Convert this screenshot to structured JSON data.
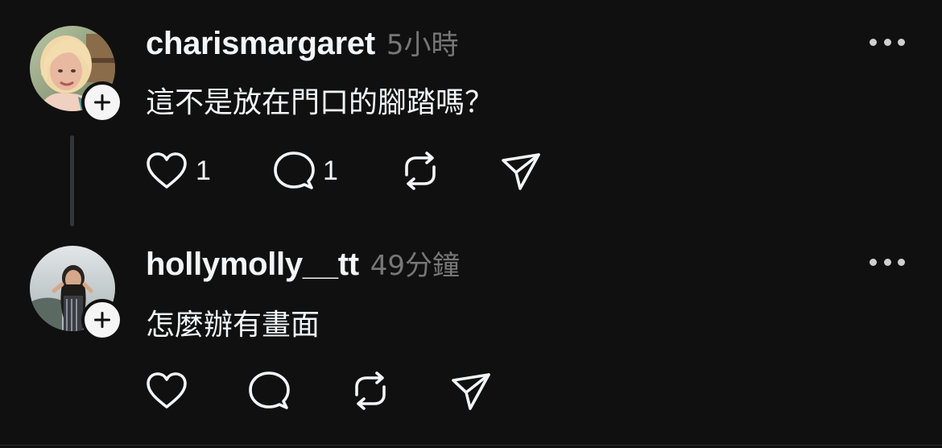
{
  "comments": [
    {
      "username": "charismargaret",
      "timestamp": "5小時",
      "text": "這不是放在門口的腳踏嗎？",
      "like_count": "1",
      "reply_count": "1",
      "avatar_icon": "avatar-photo",
      "follow_icon": "plus-icon"
    },
    {
      "username": "hollymolly__tt",
      "timestamp": "49分鐘",
      "text": "怎麼辦有畫面",
      "like_count": "",
      "reply_count": "",
      "avatar_icon": "avatar-photo",
      "follow_icon": "plus-icon"
    }
  ],
  "actions": {
    "like_icon": "heart-icon",
    "reply_icon": "comment-icon",
    "repost_icon": "repost-icon",
    "share_icon": "send-icon",
    "more_icon": "more-horizontal-icon"
  },
  "colors": {
    "background": "#101010",
    "text": "#f3f5f7",
    "muted": "#777777",
    "thread_line": "#333638"
  }
}
